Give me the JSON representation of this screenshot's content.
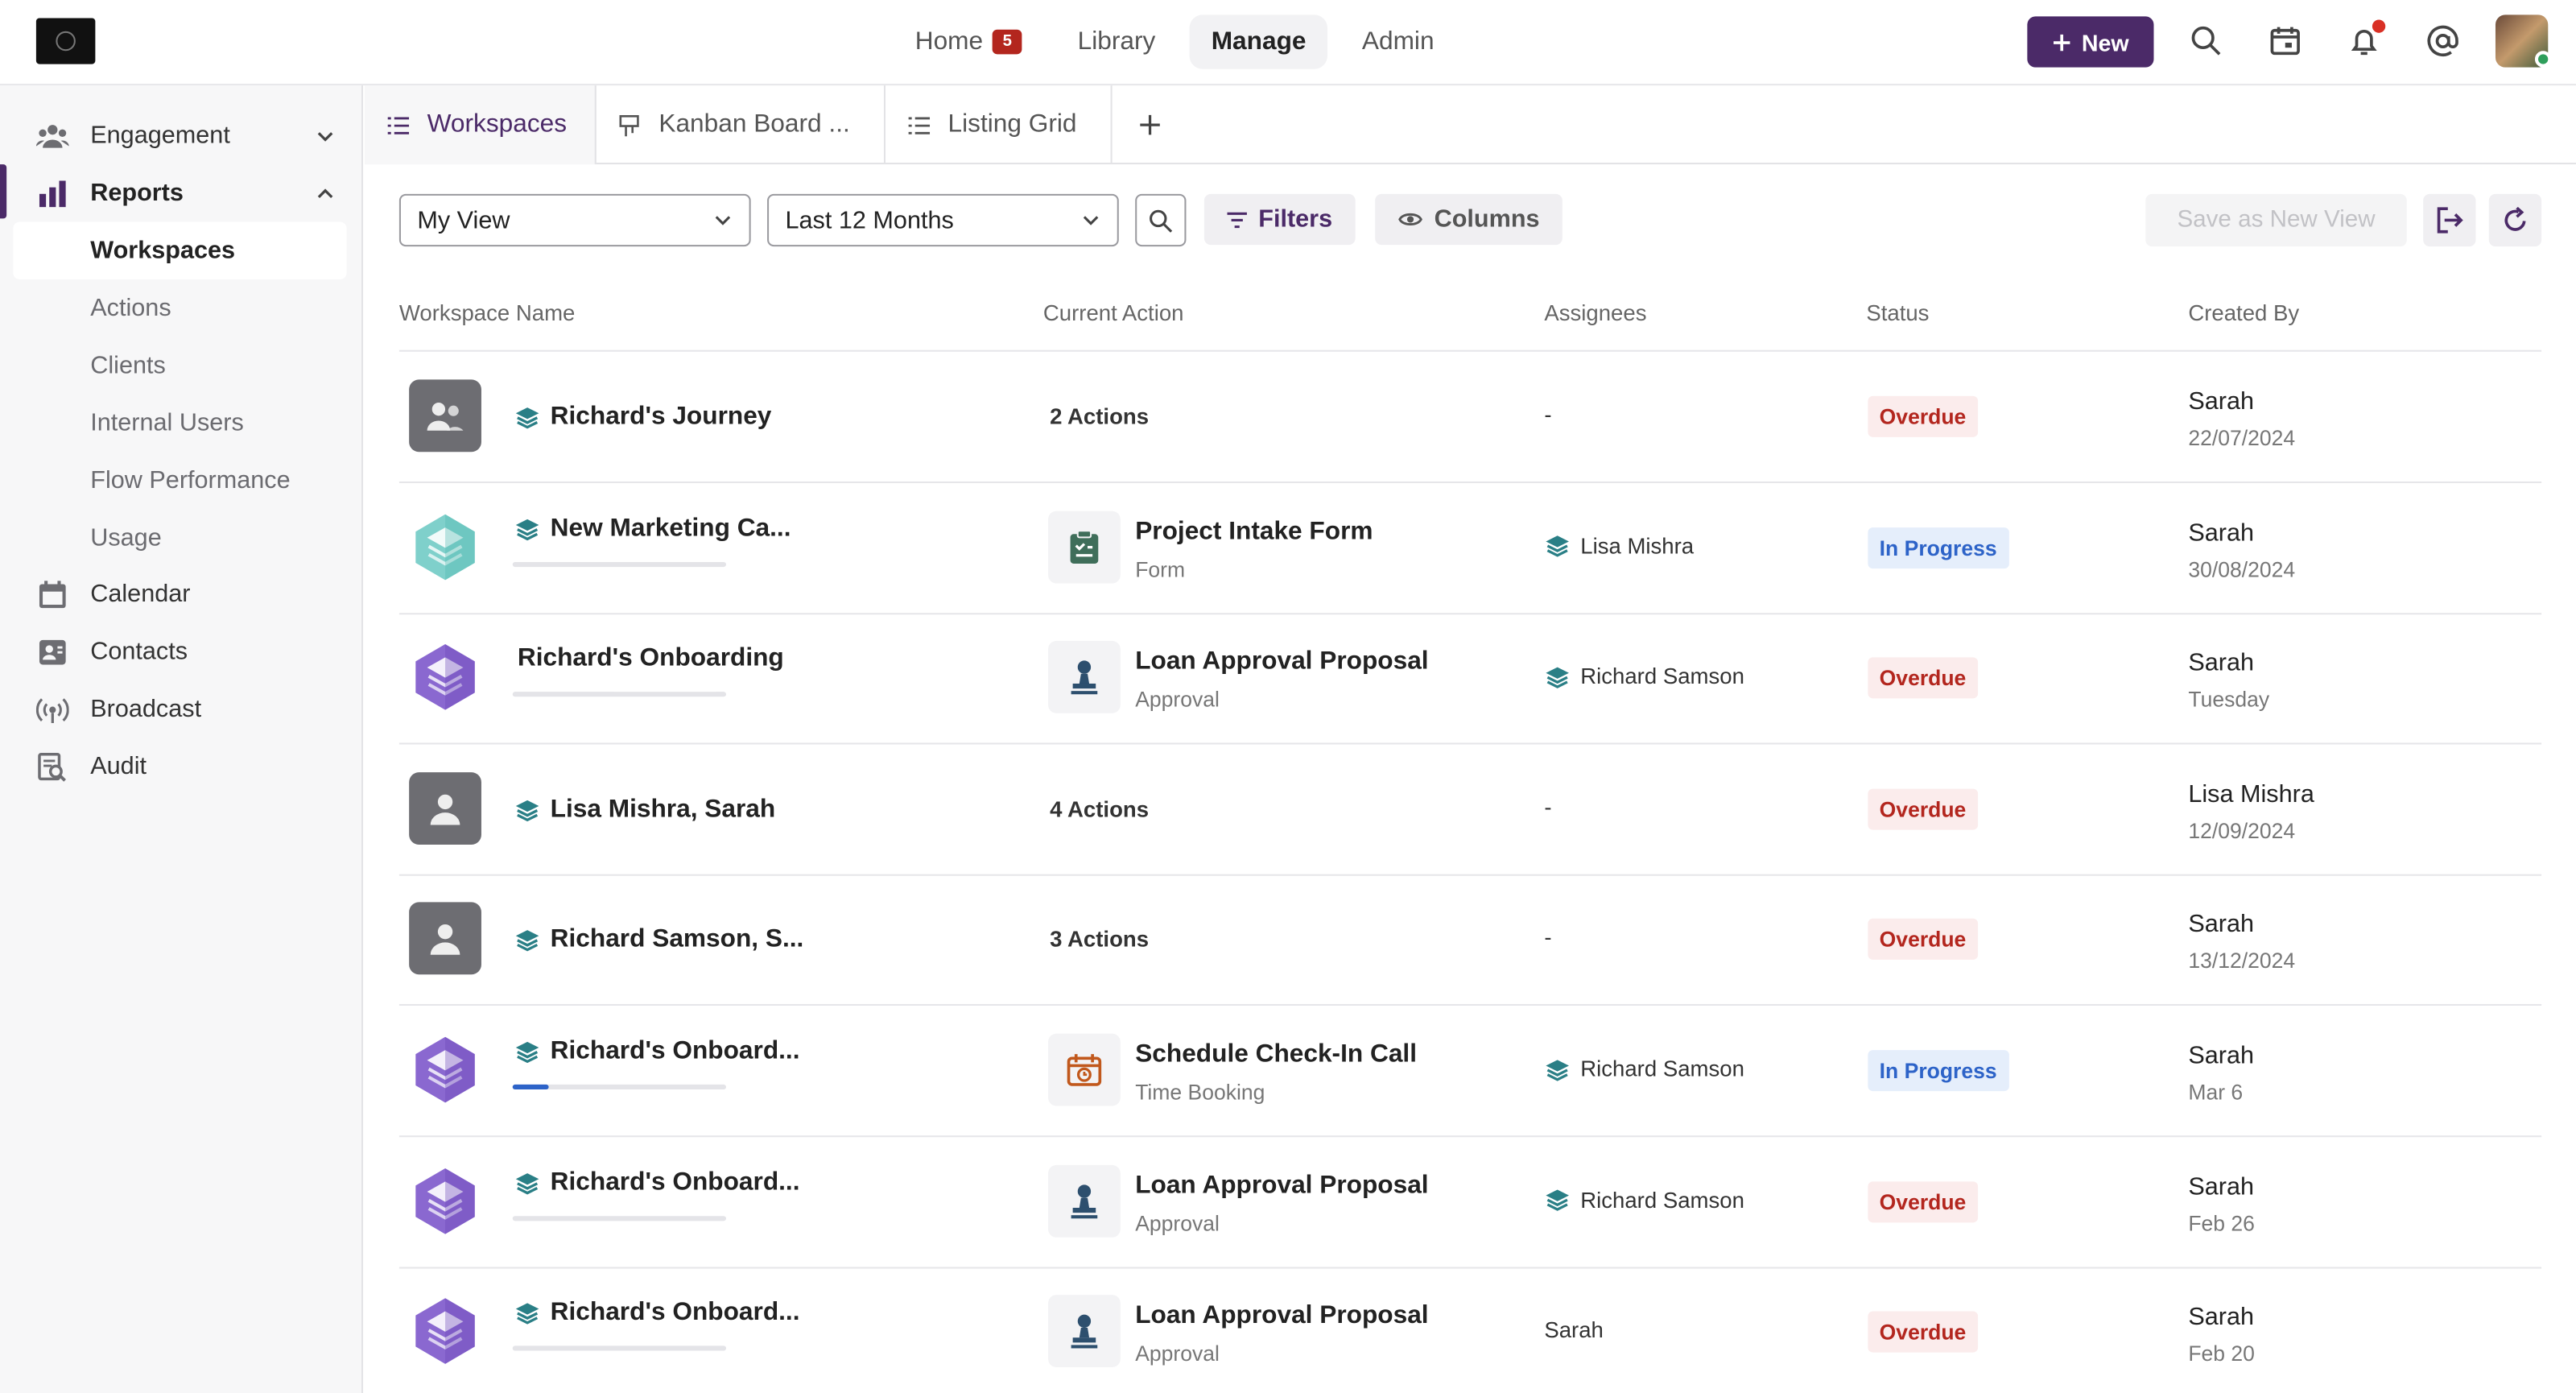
{
  "header": {
    "nav": [
      {
        "label": "Home",
        "badge": "5"
      },
      {
        "label": "Library"
      },
      {
        "label": "Manage",
        "active": true
      },
      {
        "label": "Admin"
      }
    ],
    "new_label": "New",
    "icons": [
      "search-icon",
      "calendar-icon",
      "bell-icon",
      "at-icon"
    ]
  },
  "sidebar": {
    "items": [
      {
        "label": "Engagement",
        "icon": "people-icon",
        "expandable": true
      },
      {
        "label": "Reports",
        "icon": "bar-chart-icon",
        "expanded": true
      },
      {
        "label": "Calendar",
        "icon": "calendar-icon"
      },
      {
        "label": "Contacts",
        "icon": "contacts-icon"
      },
      {
        "label": "Broadcast",
        "icon": "broadcast-icon"
      },
      {
        "label": "Audit",
        "icon": "audit-icon"
      }
    ],
    "sub_items": [
      "Workspaces",
      "Actions",
      "Clients",
      "Internal Users",
      "Flow Performance",
      "Usage"
    ]
  },
  "tabs": [
    {
      "label": "Workspaces",
      "active": true
    },
    {
      "label": "Kanban Board ..."
    },
    {
      "label": "Listing Grid"
    }
  ],
  "toolbar": {
    "view_select": "My View",
    "range_select": "Last 12 Months",
    "filters_label": "Filters",
    "columns_label": "Columns",
    "save_view_label": "Save as New View"
  },
  "table": {
    "columns": [
      "Workspace Name",
      "Current Action",
      "Assignees",
      "Status",
      "Created By"
    ],
    "rows": [
      {
        "name": "Richard's Journey",
        "icon": "group",
        "action_count": "2 Actions",
        "assignee": "-",
        "status": "Overdue",
        "created_by": "Sarah",
        "date": "22/07/2024"
      },
      {
        "name": "New Marketing Ca...",
        "icon": "teal",
        "progress": 0,
        "action_title": "Project Intake Form",
        "action_type": "Form",
        "action_icon": "form",
        "assignee": "Lisa Mishra",
        "assignee_stack": true,
        "status": "In Progress",
        "created_by": "Sarah",
        "date": "30/08/2024"
      },
      {
        "name": "Richard's Onboarding",
        "icon": "purple",
        "progress": 0,
        "no_stack": true,
        "action_title": "Loan Approval Proposal",
        "action_type": "Approval",
        "action_icon": "approval",
        "assignee": "Richard Samson",
        "assignee_stack": true,
        "status": "Overdue",
        "created_by": "Sarah",
        "date": "Tuesday"
      },
      {
        "name": "Lisa Mishra, Sarah",
        "icon": "person",
        "action_count": "4 Actions",
        "assignee": "-",
        "status": "Overdue",
        "created_by": "Lisa Mishra",
        "date": "12/09/2024"
      },
      {
        "name": "Richard Samson, S...",
        "icon": "person",
        "action_count": "3 Actions",
        "assignee": "-",
        "status": "Overdue",
        "created_by": "Sarah",
        "date": "13/12/2024"
      },
      {
        "name": "Richard's Onboard...",
        "icon": "purple",
        "progress": 0.17,
        "action_title": "Schedule Check-In Call",
        "action_type": "Time Booking",
        "action_icon": "booking",
        "assignee": "Richard Samson",
        "assignee_stack": true,
        "status": "In Progress",
        "created_by": "Sarah",
        "date": "Mar 6"
      },
      {
        "name": "Richard's Onboard...",
        "icon": "purple",
        "progress": 0,
        "action_title": "Loan Approval Proposal",
        "action_type": "Approval",
        "action_icon": "approval",
        "assignee": "Richard Samson",
        "assignee_stack": true,
        "status": "Overdue",
        "created_by": "Sarah",
        "date": "Feb 26"
      },
      {
        "name": "Richard's Onboard...",
        "icon": "purple",
        "progress": 0,
        "action_title": "Loan Approval Proposal",
        "action_type": "Approval",
        "action_icon": "approval",
        "assignee": "Sarah",
        "status": "Overdue",
        "created_by": "Sarah",
        "date": "Feb 20"
      }
    ]
  },
  "colors": {
    "brand": "#4b2a68",
    "overdue": "#b3261e",
    "in_progress": "#2d63c8"
  }
}
